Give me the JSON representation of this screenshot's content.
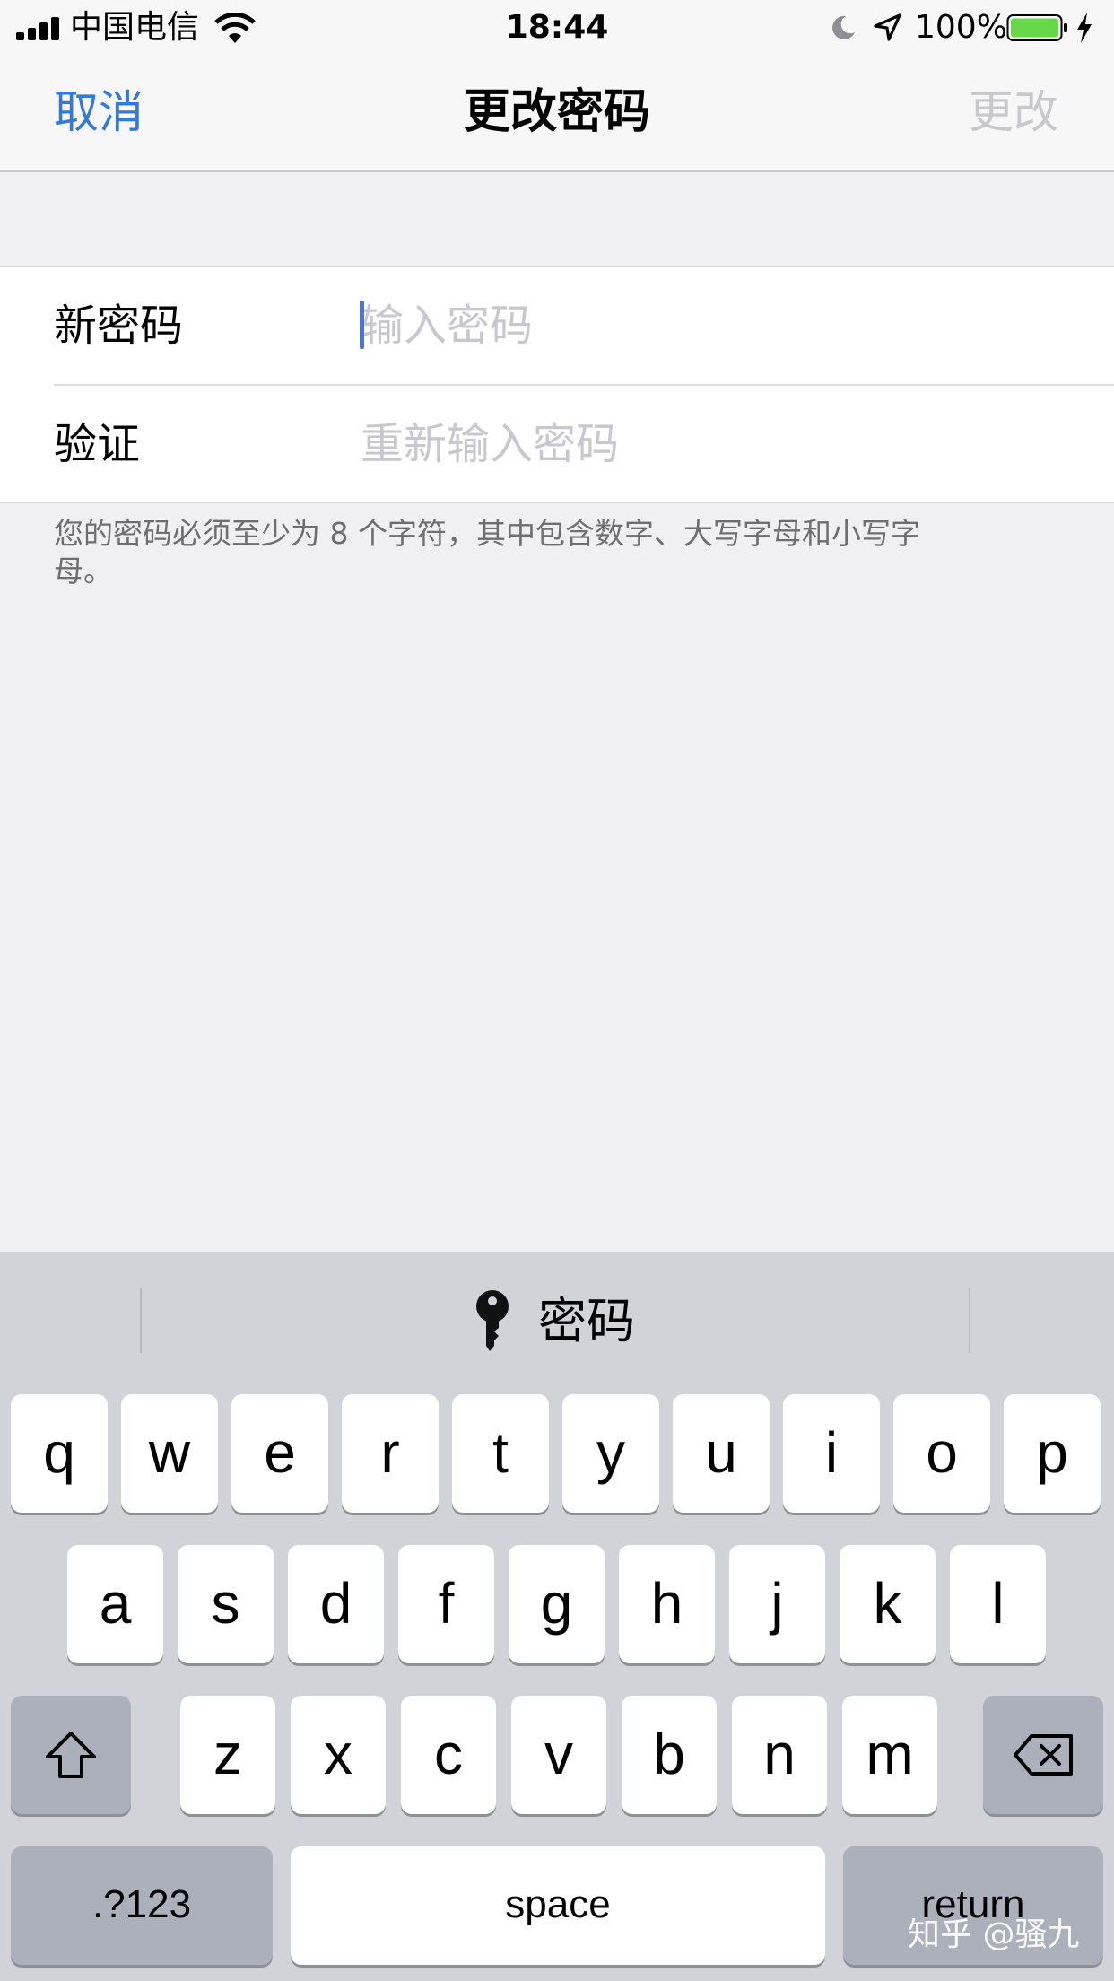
{
  "status_bar": {
    "carrier": "中国电信",
    "time": "18:44",
    "battery": "100%",
    "battery_level": 1.0,
    "icons": [
      "signal-icon",
      "wifi-icon",
      "moon-icon",
      "location-arrow-icon",
      "battery-icon",
      "charging-bolt-icon"
    ]
  },
  "nav": {
    "cancel": "取消",
    "title": "更改密码",
    "change": "更改"
  },
  "form": {
    "new_password_label": "新密码",
    "new_password_value": "",
    "new_password_placeholder": "输入密码",
    "verify_label": "验证",
    "verify_value": "",
    "verify_placeholder": "重新输入密码",
    "hint": "您的密码必须至少为 8 个字符，其中包含数字、大写字母和小写字母。"
  },
  "keyboard": {
    "suggestion": {
      "icon": "key-icon",
      "label": "密码"
    },
    "row1": [
      "q",
      "w",
      "e",
      "r",
      "t",
      "y",
      "u",
      "i",
      "o",
      "p"
    ],
    "row2": [
      "a",
      "s",
      "d",
      "f",
      "g",
      "h",
      "j",
      "k",
      "l"
    ],
    "row3": [
      "z",
      "x",
      "c",
      "v",
      "b",
      "n",
      "m"
    ],
    "shift_icon": "shift-arrow-icon",
    "delete_icon": "delete-backspace-icon",
    "numbers_label": ".?123",
    "space_label": "space",
    "return_label": "return"
  },
  "watermark": "知乎 @骚九",
  "colors": {
    "accent": "#3478d9",
    "disabled": "#c7c7cc",
    "caret": "#4a73e8",
    "battery_fill": "#66d84a",
    "background": "#efeff4",
    "keyboard_bg": "#d1d3d9"
  }
}
